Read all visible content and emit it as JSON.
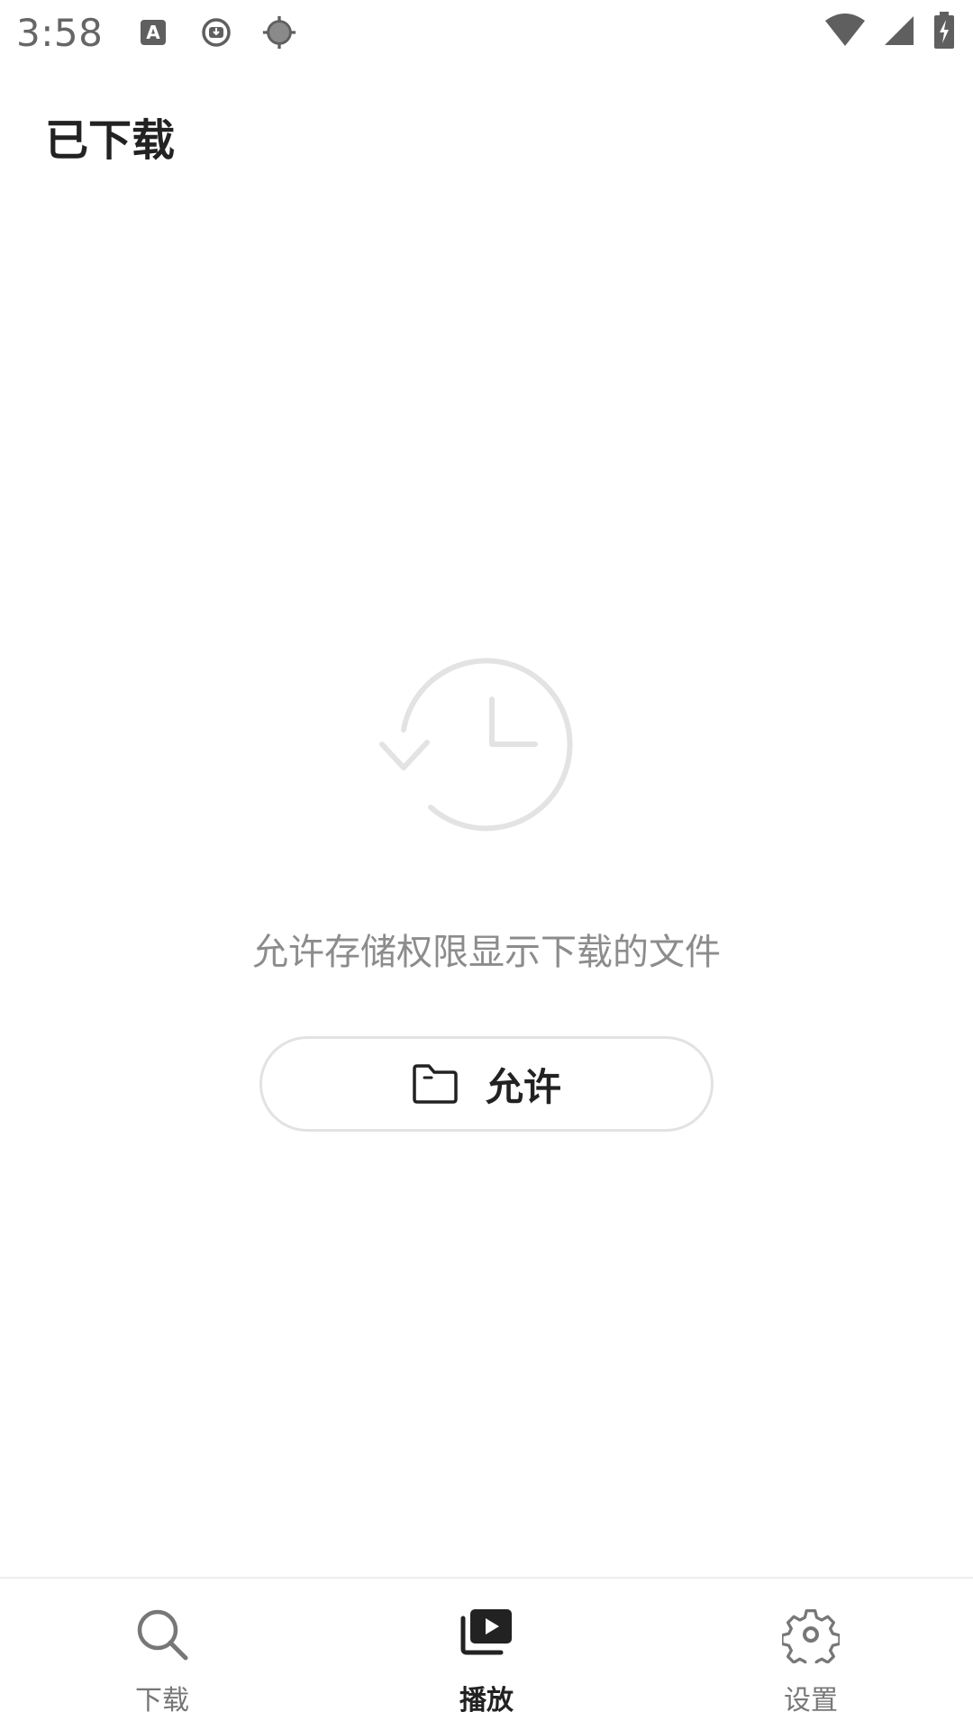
{
  "status_bar": {
    "time": "3:58",
    "left_icons": [
      "a-box-icon",
      "download-circle-icon",
      "target-icon"
    ],
    "right_icons": [
      "wifi-icon",
      "signal-icon",
      "battery-charging-icon"
    ]
  },
  "header": {
    "title": "已下载"
  },
  "empty_state": {
    "icon": "history-clock-icon",
    "message": "允许存储权限显示下载的文件",
    "button_label": "允许",
    "button_icon": "folder-icon"
  },
  "bottom_nav": {
    "items": [
      {
        "label": "下载",
        "icon": "search-icon",
        "active": false
      },
      {
        "label": "播放",
        "icon": "play-library-icon",
        "active": true
      },
      {
        "label": "设置",
        "icon": "gear-icon",
        "active": false
      }
    ]
  },
  "colors": {
    "title": "#222222",
    "muted_text": "#8c8c8c",
    "icon_gray": "#e3e3e3",
    "nav_inactive": "#777777"
  }
}
